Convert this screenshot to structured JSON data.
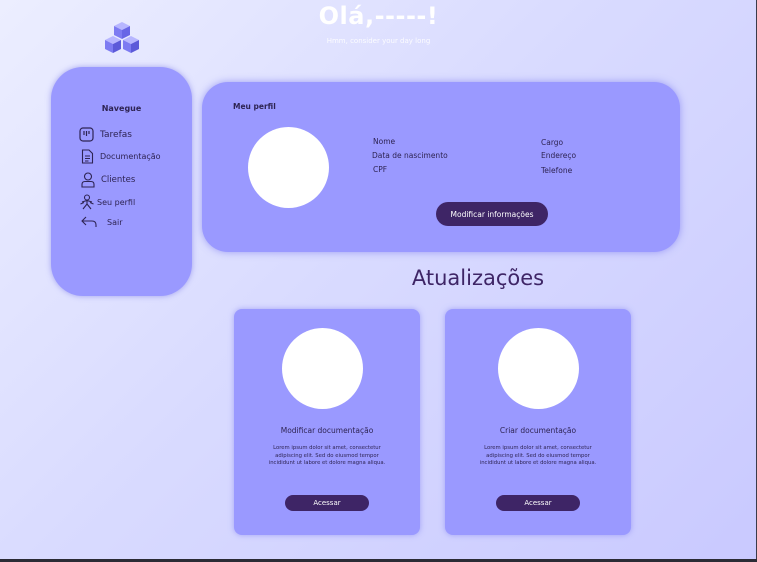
{
  "header": {
    "greeting": "Olá,-----!",
    "subtitle": "Hmm, consider your day long"
  },
  "sidebar": {
    "title": "Navegue",
    "items": [
      {
        "label": "Tarefas",
        "icon": "tasks-icon"
      },
      {
        "label": "Documentação",
        "icon": "document-icon"
      },
      {
        "label": "Clientes",
        "icon": "user-icon"
      },
      {
        "label": "Seu perfil",
        "icon": "profile-icon"
      },
      {
        "label": "Sair",
        "icon": "back-arrow-icon"
      }
    ]
  },
  "profile": {
    "heading": "Meu perfil",
    "fields_left": [
      "Nome",
      "Data de nascimento",
      "CPF"
    ],
    "fields_right": [
      "Cargo",
      "Endereço",
      "Telefone"
    ],
    "button_label": "Modificar informações"
  },
  "updates": {
    "title": "Atualizações",
    "cards": [
      {
        "title": "Modificar documentação",
        "description": "Lorem ipsum dolor sit amet, consectetur adipiscing elit. Sed do eiusmod tempor incididunt ut labore et dolore magna aliqua.",
        "button_label": "Acessar"
      },
      {
        "title": "Criar documentação",
        "description": "Lorem ipsum dolor sit amet, consectetur adipiscing elit. Sed do eiusmod tempor incididunt ut labore et dolore magna aliqua.",
        "button_label": "Acessar"
      }
    ]
  },
  "colors": {
    "accent": "#9a99ff",
    "button": "#3e2566",
    "text_dark": "#2e2453"
  }
}
